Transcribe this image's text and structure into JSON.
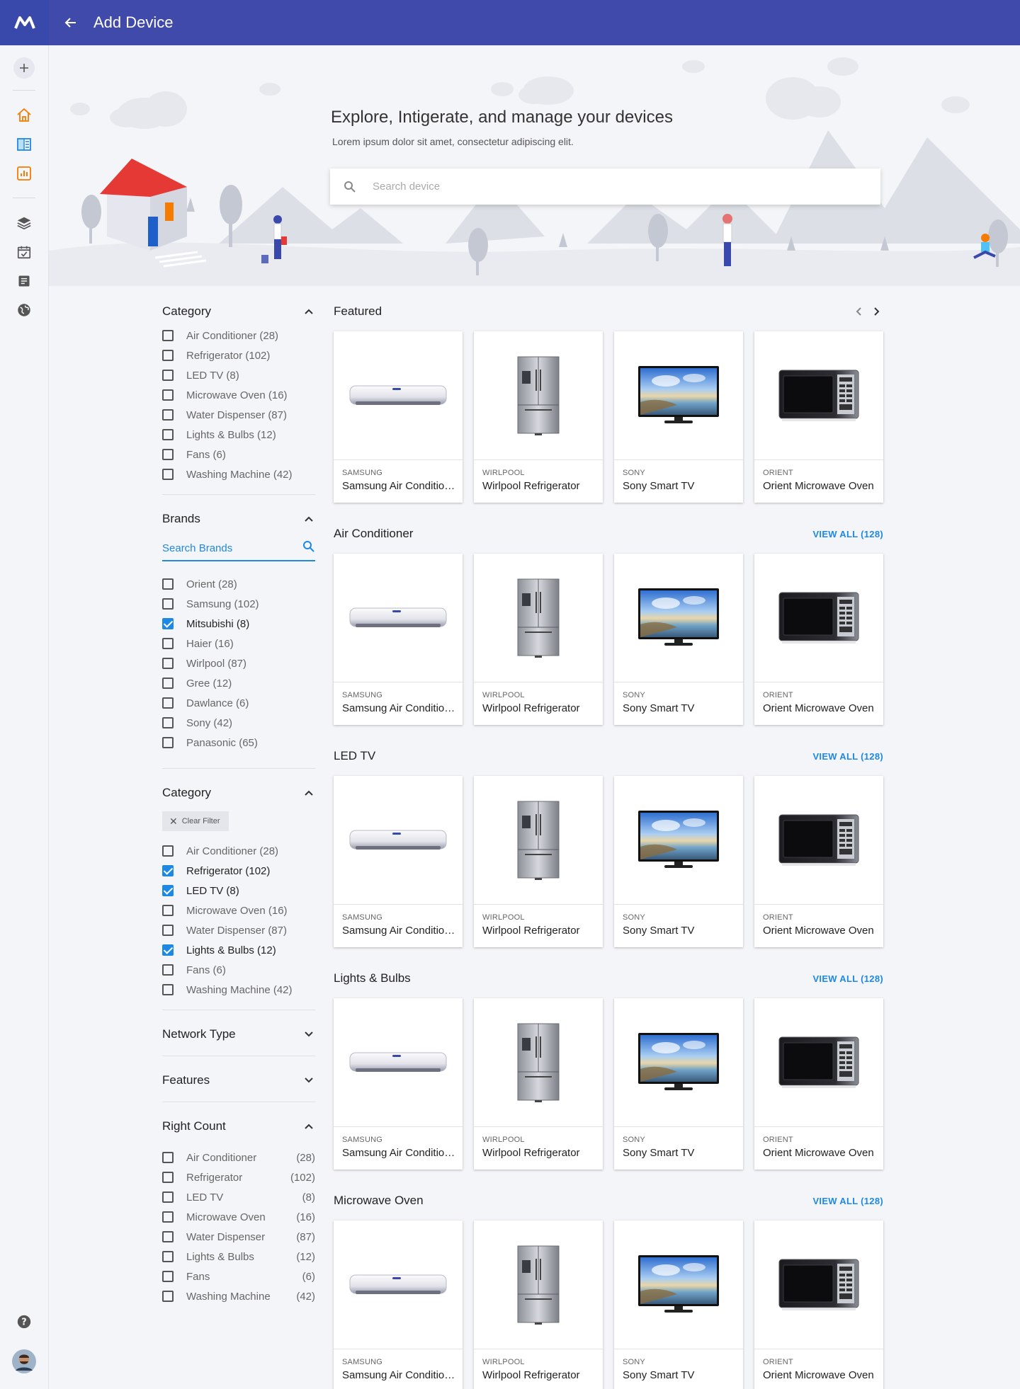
{
  "app": {
    "title": "Add Device"
  },
  "hero": {
    "title": "Explore, Intigerate, and manage your devices",
    "subtitle": "Lorem ipsum dolor sit amet, consectetur adipiscing elit.",
    "search_placeholder": "Search device"
  },
  "filters": {
    "category": {
      "title": "Category",
      "items": [
        {
          "label": "Air Conditioner (28)",
          "checked": false
        },
        {
          "label": "Refrigerator (102)",
          "checked": false
        },
        {
          "label": "LED TV (8)",
          "checked": false
        },
        {
          "label": "Microwave Oven (16)",
          "checked": false
        },
        {
          "label": "Water Dispenser (87)",
          "checked": false
        },
        {
          "label": "Lights & Bulbs (12)",
          "checked": false
        },
        {
          "label": "Fans (6)",
          "checked": false
        },
        {
          "label": "Washing Machine (42)",
          "checked": false
        }
      ]
    },
    "brands": {
      "title": "Brands",
      "search_placeholder": "Search Brands",
      "items": [
        {
          "label": "Orient (28)",
          "checked": false
        },
        {
          "label": "Samsung (102)",
          "checked": false
        },
        {
          "label": "Mitsubishi (8)",
          "checked": true
        },
        {
          "label": "Haier (16)",
          "checked": false
        },
        {
          "label": "Wirlpool (87)",
          "checked": false
        },
        {
          "label": "Gree (12)",
          "checked": false
        },
        {
          "label": "Dawlance (6)",
          "checked": false
        },
        {
          "label": "Sony (42)",
          "checked": false
        },
        {
          "label": "Panasonic (65)",
          "checked": false
        }
      ]
    },
    "category2": {
      "title": "Category",
      "clear_label": "Clear Filter",
      "items": [
        {
          "label": "Air Conditioner (28)",
          "checked": false
        },
        {
          "label": "Refrigerator (102)",
          "checked": true
        },
        {
          "label": "LED TV (8)",
          "checked": true
        },
        {
          "label": "Microwave Oven (16)",
          "checked": false
        },
        {
          "label": "Water Dispenser (87)",
          "checked": false
        },
        {
          "label": "Lights & Bulbs (12)",
          "checked": true
        },
        {
          "label": "Fans (6)",
          "checked": false
        },
        {
          "label": "Washing Machine (42)",
          "checked": false
        }
      ]
    },
    "network_type": {
      "title": "Network Type"
    },
    "features": {
      "title": "Features"
    },
    "right_count": {
      "title": "Right Count",
      "items": [
        {
          "label": "Air Conditioner",
          "count": "(28)"
        },
        {
          "label": "Refrigerator",
          "count": "(102)"
        },
        {
          "label": "LED TV",
          "count": "(8)"
        },
        {
          "label": "Microwave Oven",
          "count": "(16)"
        },
        {
          "label": "Water Dispenser",
          "count": "(87)"
        },
        {
          "label": "Lights & Bulbs",
          "count": "(12)"
        },
        {
          "label": "Fans",
          "count": "(6)"
        },
        {
          "label": "Washing Machine",
          "count": "(42)"
        }
      ]
    }
  },
  "products": [
    {
      "brand": "SAMSUNG",
      "name": "Samsung Air Conditioner",
      "kind": "ac"
    },
    {
      "brand": "WIRLPOOL",
      "name": "Wirlpool Refrigerator",
      "kind": "fridge"
    },
    {
      "brand": "SONY",
      "name": "Sony Smart TV",
      "kind": "tv"
    },
    {
      "brand": "ORIENT",
      "name": "Orient Microwave Oven",
      "kind": "microwave"
    }
  ],
  "sections": [
    {
      "title": "Featured",
      "view_all": ""
    },
    {
      "title": "Air Conditioner",
      "view_all": "VIEW ALL (128)"
    },
    {
      "title": "LED TV",
      "view_all": "VIEW ALL (128)"
    },
    {
      "title": "Lights & Bulbs",
      "view_all": "VIEW ALL (128)"
    },
    {
      "title": "Microwave Oven",
      "view_all": "VIEW ALL (128)"
    }
  ],
  "colors": {
    "primary": "#3f4aab",
    "accent": "#1e88e5",
    "nav_orange": "#f57c00"
  },
  "rail_icons": [
    "add-icon",
    "home-icon",
    "book-icon",
    "chart-icon",
    "layers-icon",
    "calendar-check-icon",
    "notes-icon",
    "globe-icon",
    "help-icon",
    "avatar"
  ]
}
